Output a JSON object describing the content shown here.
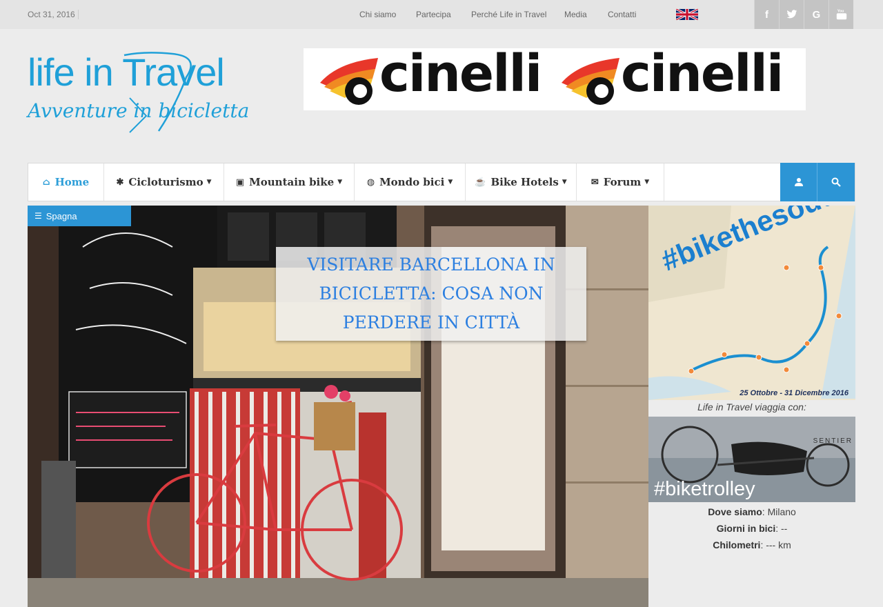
{
  "topbar": {
    "date": "Oct 31, 2016",
    "links": [
      "Chi siamo",
      "Partecipa",
      "Perché Life in Travel",
      "Media",
      "Contatti"
    ],
    "language_flag": "uk-flag-icon",
    "socials": [
      {
        "icon": "facebook-icon",
        "glyph": "f"
      },
      {
        "icon": "twitter-icon",
        "glyph": "🐦"
      },
      {
        "icon": "google-icon",
        "glyph": "G"
      },
      {
        "icon": "youtube-icon",
        "glyph": "▶"
      }
    ]
  },
  "header": {
    "logo_line1": "life in Travel",
    "logo_line2": "Avventure in bicicletta",
    "banner_text": "cinelli",
    "logo_color": "#1fa0d8"
  },
  "nav": {
    "items": [
      {
        "label": "Home",
        "icon": "home-icon",
        "glyph": "⌂",
        "dropdown": false
      },
      {
        "label": "Cicloturismo",
        "icon": "gear-icon",
        "glyph": "✱",
        "dropdown": true
      },
      {
        "label": "Mountain bike",
        "icon": "image-icon",
        "glyph": "▣",
        "dropdown": true
      },
      {
        "label": "Mondo bici",
        "icon": "globe-icon",
        "glyph": "◍",
        "dropdown": true
      },
      {
        "label": "Bike Hotels",
        "icon": "coffee-icon",
        "glyph": "☕",
        "dropdown": true
      },
      {
        "label": "Forum",
        "icon": "comments-icon",
        "glyph": "✉",
        "dropdown": true
      }
    ],
    "user_icon": "user-icon",
    "search_icon": "search-icon",
    "accent": "#2c95d5"
  },
  "hero": {
    "category": "Spagna",
    "title": "Visitare Barcellona in bicicletta: cosa non perdere in città"
  },
  "sidebar": {
    "map_hashtag": "#bikethesouth",
    "map_dates": "25 Ottobre - 31 Dicembre 2016",
    "caption": "Life in Travel viaggia con:",
    "trolley_tag": "#biketrolley",
    "trolley_brand": "SENTIER",
    "stats": [
      {
        "label": "Dove siamo",
        "value": "Milano"
      },
      {
        "label": "Giorni in bici",
        "value": "--"
      },
      {
        "label": "Chilometri",
        "value": "--- km"
      }
    ]
  }
}
